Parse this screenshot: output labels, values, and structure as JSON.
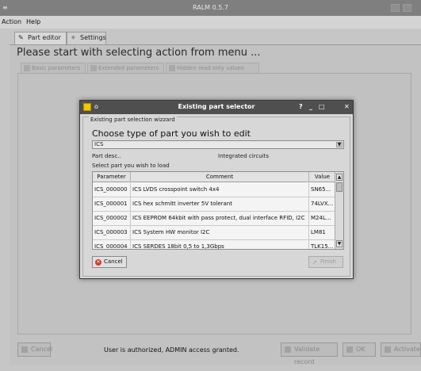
{
  "window": {
    "title": "RALM 0.5.7"
  },
  "menu": {
    "items": [
      "Action",
      "Help"
    ]
  },
  "main_tabs": [
    {
      "label": "Part editor",
      "icon": "pencil-icon"
    },
    {
      "label": "Settings",
      "icon": "wrench-icon"
    }
  ],
  "headline": "Please start with selecting action from menu ...",
  "sub_tabs": [
    "Basic parameters",
    "Extended parameters",
    "Hidden read only values"
  ],
  "bottom": {
    "cancel_label": "Cancel",
    "status": "User is authorized, ADMIN access granted.",
    "validate_label": "Validate record",
    "ok_label": "OK",
    "activate_label": "Activate"
  },
  "dialog": {
    "title": "Existing part selector",
    "title_buttons": [
      "?",
      "_",
      "□",
      "✕"
    ],
    "group_label": "Existing part selection wizzard",
    "heading": "Choose type of  part you wish to edit",
    "combo_value": "ICS",
    "part_desc_label": "Part desc..",
    "part_desc_value": "Integrated circuits",
    "select_label": "Select part you wish to load",
    "columns": [
      "Parameter",
      "Comment",
      "Value"
    ],
    "rows": [
      [
        "ICS_000000",
        "ICS LVDS crosspoint switch 4x4",
        "SN65..."
      ],
      [
        "ICS_000001",
        "ICS hex schmitt inverter 5V tolerant",
        "74LVX..."
      ],
      [
        "ICS_000002",
        "ICS EEPROM 64kbit with pass protect, dual interface RFID, I2C",
        "M24L..."
      ],
      [
        "ICS_000003",
        "ICS System HW monitor I2C",
        "LM81"
      ],
      [
        "ICS_000004",
        "ICS SERDES 18bit 0,5 to 1,3Gbps",
        "TLK15..."
      ]
    ],
    "cancel_label": "Cancel",
    "finish_label": "Finish"
  }
}
